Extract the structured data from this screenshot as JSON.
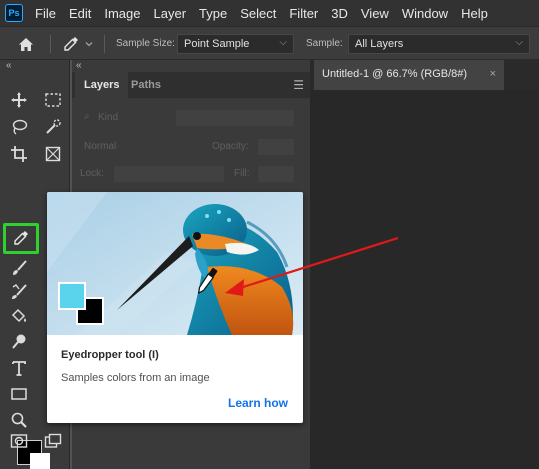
{
  "app": {
    "logo_text": "Ps"
  },
  "menu": [
    "File",
    "Edit",
    "Image",
    "Layer",
    "Type",
    "Select",
    "Filter",
    "3D",
    "View",
    "Window",
    "Help"
  ],
  "options_bar": {
    "sample_size_label": "Sample Size:",
    "sample_size_value": "Point Sample",
    "sample_label": "Sample:",
    "sample_value": "All Layers"
  },
  "panels": {
    "tabs": [
      "Layers",
      "Paths"
    ],
    "active_tab": "Layers",
    "filter_placeholder": "Kind",
    "blend_mode": "Normal",
    "opacity_label": "Opacity:",
    "lock_label": "Lock:",
    "fill_label": "Fill:"
  },
  "document": {
    "tab_title": "Untitled-1 @ 66.7% (RGB/8#)",
    "close_glyph": "×"
  },
  "tooltip": {
    "title": "Eyedropper tool (I)",
    "description": "Samples colors from an image",
    "link": "Learn how"
  },
  "colors": {
    "highlight": "#2fd12f",
    "arrow": "#e01919",
    "link": "#1473e6",
    "foreground_color": "#000000",
    "background_color": "#ffffff",
    "sampled_color": "#5ad4ec"
  },
  "icons": {
    "toolbar": [
      "move-icon",
      "marquee-icon",
      "lasso-icon",
      "quick-select-icon",
      "crop-icon",
      "frame-icon",
      "eyedropper-icon",
      "healing-brush-icon",
      "brush-icon",
      "clone-stamp-icon",
      "history-brush-icon",
      "eraser-icon",
      "paint-bucket-icon",
      "blur-icon",
      "dodge-icon",
      "pen-icon",
      "type-icon",
      "path-select-icon",
      "rectangle-icon",
      "hand-icon",
      "zoom-icon",
      "quick-mask-icon",
      "screen-mode-icon"
    ]
  }
}
